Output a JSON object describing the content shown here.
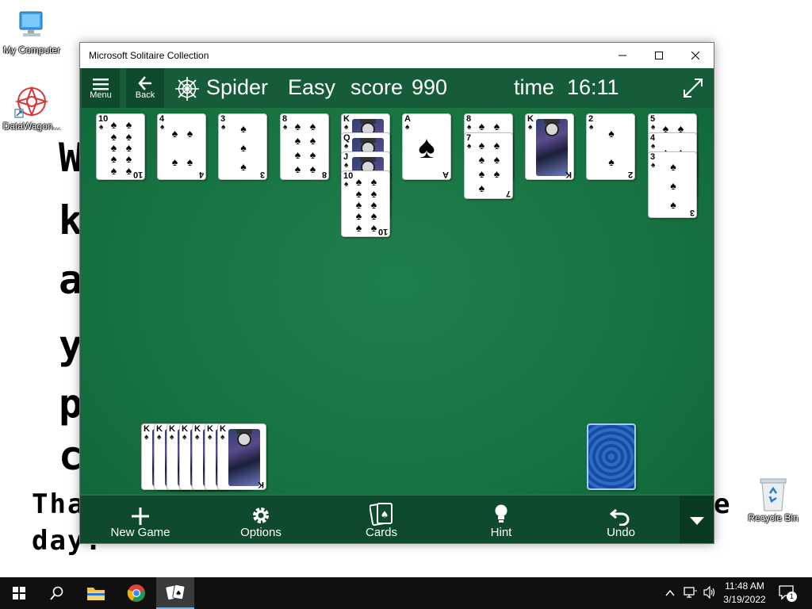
{
  "desktop": {
    "icons": [
      {
        "label": "My Computer"
      },
      {
        "label": "DataWagon..."
      },
      {
        "label": "Recycle Bin"
      }
    ],
    "wallpaper_lines": [
      "W",
      "k",
      "a",
      "y",
      "p",
      "c",
      "Tha",
      "e",
      "day."
    ]
  },
  "window": {
    "title": "Microsoft Solitaire Collection"
  },
  "topbar": {
    "menu_label": "Menu",
    "back_label": "Back",
    "game_name": "Spider",
    "difficulty": "Easy",
    "score_label": "score",
    "score_value": "990",
    "time_label": "time",
    "time_value": "16:11"
  },
  "tableau": [
    {
      "cards": [
        {
          "rank": "10",
          "suit": "♠"
        }
      ]
    },
    {
      "cards": [
        {
          "rank": "4",
          "suit": "♠"
        }
      ]
    },
    {
      "cards": [
        {
          "rank": "3",
          "suit": "♠"
        }
      ]
    },
    {
      "cards": [
        {
          "rank": "8",
          "suit": "♠"
        }
      ]
    },
    {
      "cards": [
        {
          "rank": "K",
          "suit": "♠"
        },
        {
          "rank": "Q",
          "suit": "♠"
        },
        {
          "rank": "J",
          "suit": "♠"
        },
        {
          "rank": "10",
          "suit": "♠"
        }
      ]
    },
    {
      "cards": [
        {
          "rank": "A",
          "suit": "♠"
        }
      ]
    },
    {
      "cards": [
        {
          "rank": "8",
          "suit": "♠"
        },
        {
          "rank": "7",
          "suit": "♠"
        }
      ]
    },
    {
      "cards": [
        {
          "rank": "K",
          "suit": "♠"
        }
      ]
    },
    {
      "cards": [
        {
          "rank": "2",
          "suit": "♠"
        }
      ]
    },
    {
      "cards": [
        {
          "rank": "5",
          "suit": "♠"
        },
        {
          "rank": "4",
          "suit": "♠"
        },
        {
          "rank": "3",
          "suit": "♠"
        }
      ]
    }
  ],
  "foundation": {
    "completed": [
      "K",
      "K",
      "K",
      "K",
      "K",
      "K",
      "K"
    ]
  },
  "bottombar": {
    "new_game": "New Game",
    "options": "Options",
    "cards": "Cards",
    "hint": "Hint",
    "undo": "Undo"
  },
  "taskbar": {
    "time": "11:48 AM",
    "date": "3/19/2022",
    "notification_count": "1"
  },
  "colors": {
    "felt": "#167241",
    "bar": "#165c38",
    "bar_dark": "#0f4a2c",
    "card_back": "#2a6cc8"
  }
}
